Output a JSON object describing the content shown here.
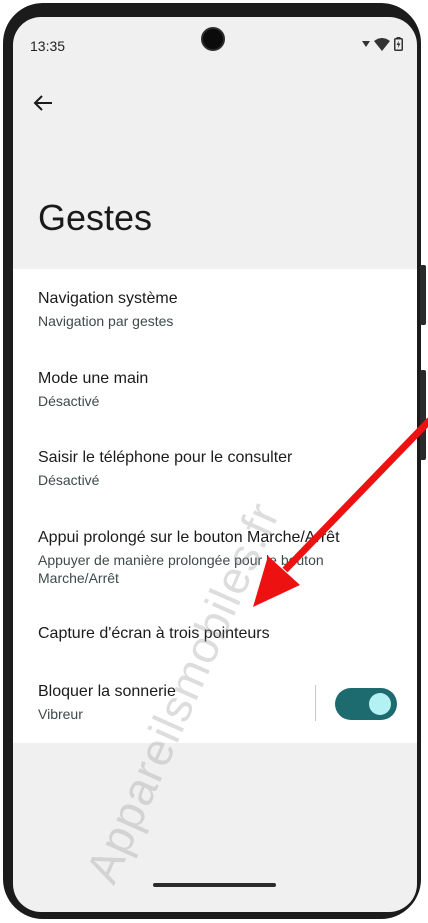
{
  "status_bar": {
    "time": "13:35"
  },
  "page": {
    "title": "Gestes"
  },
  "settings": [
    {
      "title": "Navigation système",
      "subtitle": "Navigation par gestes"
    },
    {
      "title": "Mode une main",
      "subtitle": "Désactivé"
    },
    {
      "title": "Saisir le téléphone pour le consulter",
      "subtitle": "Désactivé"
    },
    {
      "title": "Appui prolongé sur le bouton Marche/Arrêt",
      "subtitle": "Appuyer de manière prolongée pour le bouton Marche/Arrêt"
    },
    {
      "title": "Capture d'écran à trois pointeurs",
      "subtitle": ""
    },
    {
      "title": "Bloquer la sonnerie",
      "subtitle": "Vibreur"
    }
  ],
  "toggle": {
    "state": "on",
    "accent_color": "#1d6b6e"
  },
  "watermark": "Appareilsmobiles.fr",
  "annotation": {
    "arrow_color": "#ee1111"
  },
  "icons": [
    "back-arrow-icon",
    "signal-icon",
    "wifi-icon",
    "battery-icon"
  ]
}
